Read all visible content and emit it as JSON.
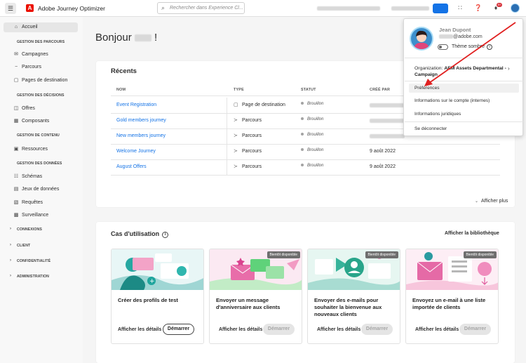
{
  "topbar": {
    "menu_icon": "hamburger-icon",
    "logo_letter": "A",
    "app_title": "Adobe Journey Optimizer",
    "search_placeholder": "Rechercher dans Experience Cl...",
    "badge_count": "9+"
  },
  "sidebar": {
    "home": "Accueil",
    "sections": [
      {
        "title": "GESTION DES PARCOURS",
        "items": [
          "Campagnes",
          "Parcours",
          "Pages de destination"
        ]
      },
      {
        "title": "GESTION DES DÉCISIONS",
        "items": [
          "Offres",
          "Composants"
        ]
      },
      {
        "title": "GESTION DE CONTENU",
        "items": [
          "Ressources"
        ]
      },
      {
        "title": "GESTION DES DONNÉES",
        "items": [
          "Schémas",
          "Jeux de données",
          "Requêtes",
          "Surveillance"
        ]
      }
    ],
    "collapsed": [
      "CONNEXIONS",
      "CLIENT",
      "CONFIDENTIALITÉ",
      "ADMINISTRATION"
    ]
  },
  "main": {
    "greeting": "Bonjour",
    "greeting_end": "!",
    "recents": {
      "title": "Récents",
      "headers": [
        "NOM",
        "TYPE",
        "STATUT",
        "CRÉÉ PAR"
      ],
      "rows": [
        {
          "name": "Event Registration",
          "type": "Page de destination",
          "status": "Brouillon",
          "date": ""
        },
        {
          "name": "Gold members journey",
          "type": "Parcours",
          "status": "Brouillon",
          "date": ""
        },
        {
          "name": "New members journey",
          "type": "Parcours",
          "status": "Brouillon",
          "date": ""
        },
        {
          "name": "Welcome Journey",
          "type": "Parcours",
          "status": "Brouillon",
          "date": "9 août 2022"
        },
        {
          "name": "August Offers",
          "type": "Parcours",
          "status": "Brouillon",
          "date": "9 août 2022"
        }
      ],
      "show_more": "Afficher plus"
    },
    "use_cases": {
      "title": "Cas d'utilisation",
      "library": "Afficher la bibliothèque",
      "soon": "Bientôt disponible",
      "details": "Afficher les détails",
      "start": "Démarrer",
      "cards": [
        {
          "title": "Créer des profils de test",
          "soon": false
        },
        {
          "title": "Envoyer un message d'anniversaire aux clients",
          "soon": true
        },
        {
          "title": "Envoyer des e-mails pour souhaiter la bienvenue aux nouveaux clients",
          "soon": true
        },
        {
          "title": "Envoyez un e-mail à une liste importée de clients",
          "soon": true
        }
      ]
    }
  },
  "profile_menu": {
    "name": "Jean Dupont",
    "email_domain": "@adobe.com",
    "theme": "Thème sombre",
    "org_label": "Organization:",
    "org_name": "AEM Assets Departmental - Campaign",
    "items": [
      "Préférences",
      "Informations sur le compte (internes)",
      "Informations juridiques",
      "Se déconnecter"
    ]
  },
  "colors": {
    "accent": "#1473e6",
    "brand": "#eb1000",
    "arrow": "#e02020"
  }
}
